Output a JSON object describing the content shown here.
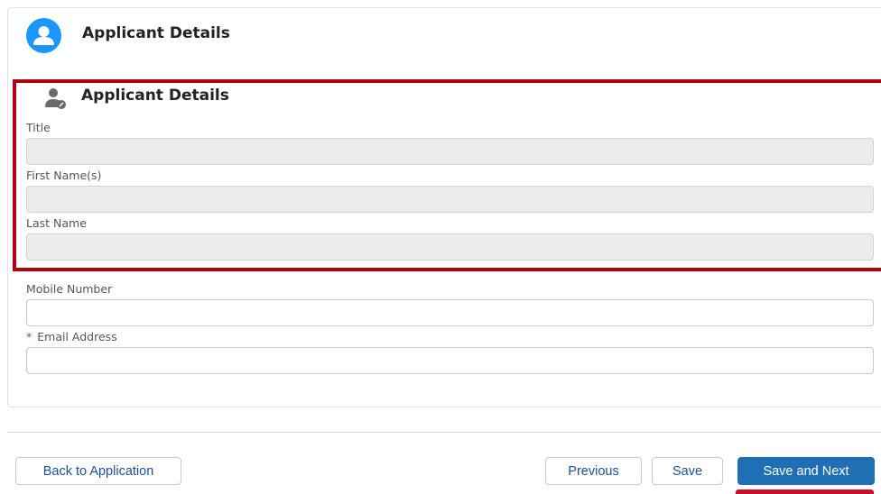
{
  "header": {
    "title": "Applicant Details",
    "icon": "user-avatar-icon"
  },
  "section": {
    "title": "Applicant Details",
    "icon": "user-edit-icon",
    "highlight_color": "#b00016"
  },
  "fields": {
    "title": {
      "label": "Title",
      "value": ""
    },
    "first_name": {
      "label": "First Name(s)",
      "value": ""
    },
    "last_name": {
      "label": "Last Name",
      "value": ""
    },
    "mobile": {
      "label": "Mobile Number",
      "value": ""
    },
    "email": {
      "label": "Email Address",
      "required_marker": "*",
      "value": ""
    }
  },
  "footer": {
    "back_label": "Back to Application",
    "previous_label": "Previous",
    "save_label": "Save",
    "save_next_label": "Save and Next"
  },
  "colors": {
    "accent": "#1b96ff",
    "primary_button": "#1f6fb5",
    "required": "#c23934"
  }
}
